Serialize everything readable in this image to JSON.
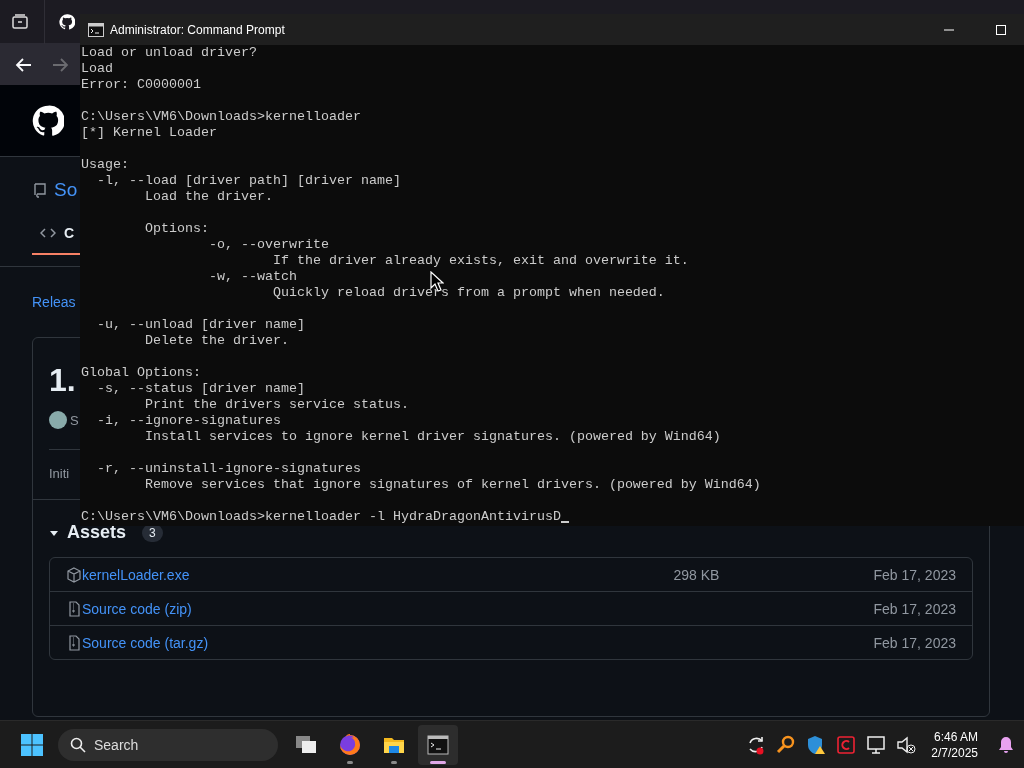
{
  "browser": {
    "navigation": {
      "back_enabled": true,
      "forward_enabled": false
    },
    "repo": {
      "name": "So",
      "tabs": [
        {
          "label": "C",
          "selected": true
        }
      ],
      "releases_link": "Releas"
    },
    "release": {
      "version": "1.",
      "author": "S",
      "body": "Initi",
      "assets": {
        "title": "Assets",
        "count": "3",
        "expanded": true,
        "items": [
          {
            "kind": "binary",
            "name": "kernelLoader.exe",
            "size": "298 KB",
            "date": "Feb 17, 2023"
          },
          {
            "kind": "source",
            "name": "Source code (zip)",
            "date": "Feb 17, 2023"
          },
          {
            "kind": "source",
            "name": "Source code (tar.gz)",
            "date": "Feb 17, 2023"
          }
        ]
      }
    }
  },
  "console": {
    "title": "Administrator: Command Prompt",
    "blocks": [
      [
        "Load or unload driver?",
        "Load",
        "Error: C0000001"
      ],
      [
        "C:\\Users\\VM6\\Downloads>kernelloader",
        "[*] Kernel Loader"
      ],
      [
        "Usage:",
        "  -l, --load [driver path] [driver name]",
        "        Load the driver."
      ],
      [
        "        Options:",
        "                -o, --overwrite",
        "                        If the driver already exists, exit and overwrite it.",
        "                -w, --watch",
        "                        Quickly reload drivers from a prompt when needed."
      ],
      [
        "  -u, --unload [driver name]",
        "        Delete the driver."
      ],
      [
        "Global Options:",
        "  -s, --status [driver name]",
        "        Print the drivers service status.",
        "  -i, --ignore-signatures",
        "        Install services to ignore kernel driver signatures. (powered by Wind64)"
      ],
      [
        "  -r, --uninstall-ignore-signatures",
        "        Remove services that ignore signatures of kernel drivers. (powered by Wind64)"
      ]
    ],
    "input": "C:\\Users\\VM6\\Downloads>kernelloader -l HydraDragonAntivirusD"
  },
  "taskbar": {
    "search_placeholder": "Search",
    "apps": [
      {
        "kind": "task-view",
        "running": false,
        "active": false
      },
      {
        "kind": "firefox",
        "running": true,
        "active": false
      },
      {
        "kind": "files",
        "running": true,
        "active": false
      },
      {
        "kind": "terminal",
        "running": true,
        "active": true
      }
    ],
    "tray": [
      {
        "kind": "sync"
      },
      {
        "kind": "search"
      },
      {
        "kind": "shield"
      },
      {
        "kind": "app"
      },
      {
        "kind": "network"
      },
      {
        "kind": "volume"
      }
    ],
    "time": "6:46 AM",
    "date": "2/7/2025"
  }
}
